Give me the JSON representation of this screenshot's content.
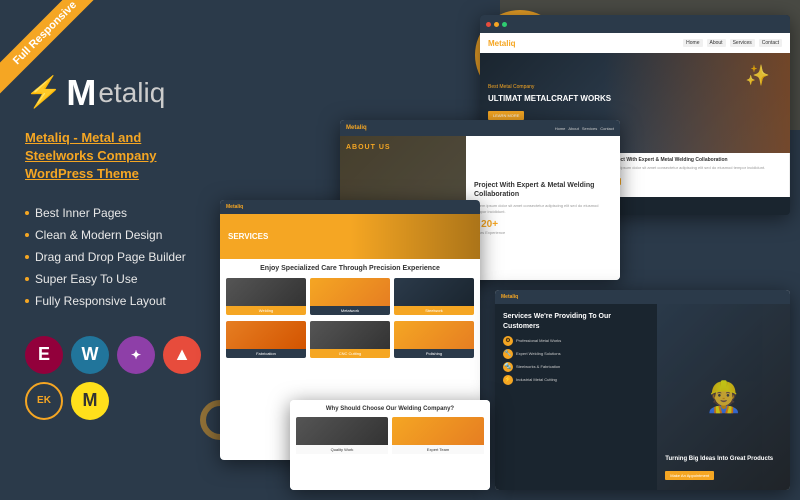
{
  "ribbon": {
    "label": "Full Responsive"
  },
  "logo": {
    "brand": "Metaliq",
    "flame_char": "🔥"
  },
  "product": {
    "title": "Metaliq  -  Metal and Steelworks Company WordPress Theme",
    "link_text": "Metaliq  -  Metal and Steelworks Company WordPress Theme"
  },
  "features": [
    {
      "text": "Best Inner Pages"
    },
    {
      "text": "Clean & Modern Design"
    },
    {
      "text": "Drag and Drop Page Builder"
    },
    {
      "text": "Super Easy To Use"
    },
    {
      "text": "Fully Responsive Layout"
    }
  ],
  "plugins": [
    {
      "name": "Elementor",
      "class": "pi-elementor",
      "symbol": "E"
    },
    {
      "name": "WordPress",
      "class": "pi-wordpress",
      "symbol": "W"
    },
    {
      "name": "Divi",
      "class": "pi-divi",
      "symbol": "D"
    },
    {
      "name": "Avada",
      "class": "pi-mountain",
      "symbol": "▲"
    },
    {
      "name": "EK",
      "class": "pi-ek",
      "symbol": "EK"
    },
    {
      "name": "Mailchimp",
      "class": "pi-mailchimp",
      "symbol": "M"
    }
  ],
  "preview": {
    "hero_title": "ULTIMAT METALCRAFT WORKS",
    "hero_subtitle": "Best Metal Company",
    "hero_btn": "LEARN MORE",
    "about_title": "Project With Expert & Metal Welding Collaboration",
    "about_text": "Lorem ipsum dolor sit amet consectetur adipiscing elit sed do eiusmod tempor incididunt.",
    "stat_1_num": "20+",
    "stat_1_label": "Years Experience",
    "services_title": "Enjoy Specialized Care Through Precision Experience",
    "customer_title": "Services We're Providing To Our Customers",
    "appointment_title": "Make An Appointment",
    "why_title": "Why Should Choose Our Welding Company?",
    "footer_title": "Turning Big Ideas Into Great Products",
    "about_section_label": "ABOUT US",
    "services_section": "SERVICES"
  }
}
